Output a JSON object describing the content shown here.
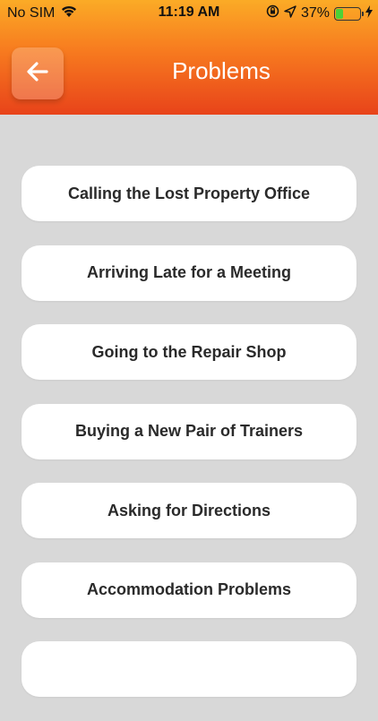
{
  "status_bar": {
    "carrier": "No SIM",
    "time": "11:19 AM",
    "battery": "37%",
    "battery_level": 0.37
  },
  "header": {
    "title": "Problems",
    "back_icon": "arrow-left-icon"
  },
  "items": [
    {
      "label": "Calling the Lost Property Office"
    },
    {
      "label": "Arriving Late for a Meeting"
    },
    {
      "label": "Going to the Repair Shop"
    },
    {
      "label": "Buying a New Pair of Trainers"
    },
    {
      "label": "Asking for Directions"
    },
    {
      "label": "Accommodation Problems"
    },
    {
      "label": ""
    }
  ],
  "colors": {
    "header_top": "#fbab26",
    "header_bottom": "#e8431a",
    "background": "#d8d8d8",
    "battery_green": "#4cd137"
  }
}
